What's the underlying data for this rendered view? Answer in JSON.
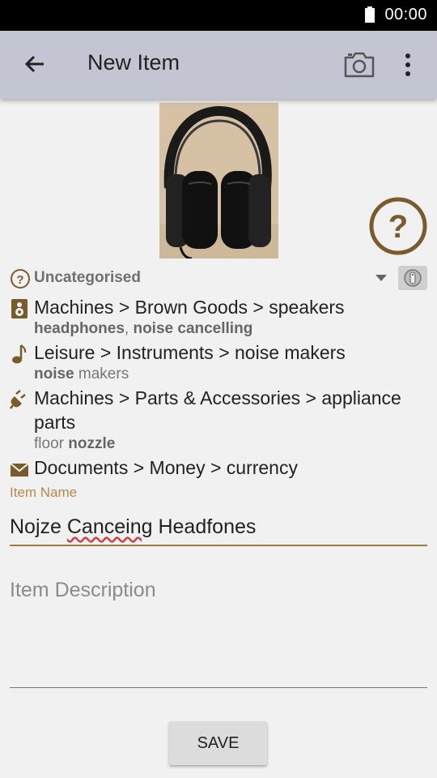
{
  "status_bar": {
    "time": "00:00"
  },
  "app_bar": {
    "title": "New Item",
    "back_icon": "arrow-back-icon",
    "camera_icon": "camera-icon",
    "menu_icon": "more-vert-icon"
  },
  "category_header": {
    "label": "Uncategorised"
  },
  "categories": [
    {
      "icon": "speaker-icon",
      "path": "Machines > Brown Goods > speakers",
      "tags": [
        {
          "text": "headphones",
          "bold": true
        },
        {
          "text": ", ",
          "bold": false
        },
        {
          "text": "noise cancelling",
          "bold": true
        }
      ]
    },
    {
      "icon": "music-note-icon",
      "path": "Leisure > Instruments > noise makers",
      "tags": [
        {
          "text": "noise",
          "bold": true
        },
        {
          "text": " makers",
          "bold": false
        }
      ]
    },
    {
      "icon": "plug-icon",
      "path": "Machines > Parts & Accessories > appliance parts",
      "tags": [
        {
          "text": "floor ",
          "bold": false
        },
        {
          "text": "nozzle",
          "bold": true
        }
      ]
    },
    {
      "icon": "mail-icon",
      "path": "Documents > Money > currency",
      "tags": []
    }
  ],
  "form": {
    "name_label": "Item Name",
    "name_value_parts": [
      "Nojze ",
      "Canceing",
      " Headfones"
    ],
    "description_placeholder": "Item Description",
    "save_label": "SAVE"
  },
  "colors": {
    "app_bar": "#c3c5d2",
    "accent": "#b38b4a",
    "help_icon": "#7a5c2c"
  }
}
